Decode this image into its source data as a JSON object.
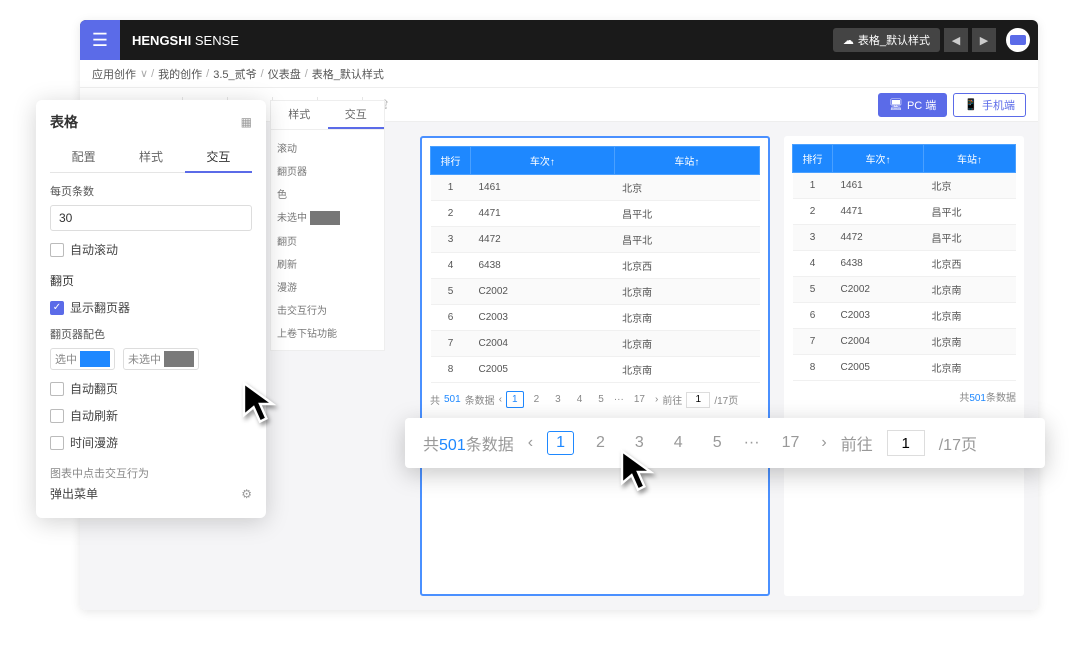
{
  "header": {
    "brand_bold": "HENGSHI",
    "brand_light": "SENSE",
    "title_chip": "表格_默认样式"
  },
  "breadcrumb": {
    "items": [
      "应用创作",
      "我的创作",
      "3.5_贰爷",
      "仪表盘",
      "表格_默认样式"
    ]
  },
  "toolbar": {
    "pc_label": "PC 端",
    "mobile_label": "手机端"
  },
  "panel": {
    "title": "表格",
    "tabs": [
      "配置",
      "样式",
      "交互"
    ],
    "per_page_label": "每页条数",
    "per_page_value": "30",
    "auto_scroll": "自动滚动",
    "paging_section": "翻页",
    "show_pager": "显示翻页器",
    "pager_colors_label": "翻页器配色",
    "selected_label": "选中",
    "unselected_label": "未选中",
    "auto_page": "自动翻页",
    "auto_refresh": "自动刷新",
    "time_roam": "时间漫游",
    "click_behavior_label": "图表中点击交互行为",
    "popup_menu": "弹出菜单",
    "selected_color": "#1e88ff",
    "unselected_color": "#7a7a7a"
  },
  "bg_panel": {
    "tabs": [
      "样式",
      "交互"
    ],
    "rows": [
      "滚动",
      "翻页器",
      "色",
      "未选中",
      "翻页",
      "刷新",
      "漫游",
      "击交互行为",
      "上卷下钻功能"
    ]
  },
  "table": {
    "headers": [
      "排行",
      "车次↑",
      "车站↑"
    ],
    "rows": [
      {
        "rank": "1",
        "train": "1461",
        "station": "北京"
      },
      {
        "rank": "2",
        "train": "4471",
        "station": "昌平北"
      },
      {
        "rank": "3",
        "train": "4472",
        "station": "昌平北"
      },
      {
        "rank": "4",
        "train": "6438",
        "station": "北京西"
      },
      {
        "rank": "5",
        "train": "C2002",
        "station": "北京南"
      },
      {
        "rank": "6",
        "train": "C2003",
        "station": "北京南"
      },
      {
        "rank": "7",
        "train": "C2004",
        "station": "北京南"
      },
      {
        "rank": "8",
        "train": "C2005",
        "station": "北京南"
      }
    ]
  },
  "pager": {
    "total_prefix": "共",
    "total_count": "501",
    "total_suffix": "条数据",
    "pages": [
      "1",
      "2",
      "3",
      "4",
      "5"
    ],
    "last_page": "17",
    "goto_label": "前往",
    "goto_value": "1",
    "page_suffix": "/17页"
  },
  "big_pager": {
    "total_prefix": "共",
    "total_count": "501",
    "total_suffix": "条数据",
    "pages": [
      "1",
      "2",
      "3",
      "4",
      "5"
    ],
    "last_page": "17",
    "goto_label": "前往",
    "goto_value": "1",
    "page_suffix": "/17页"
  }
}
